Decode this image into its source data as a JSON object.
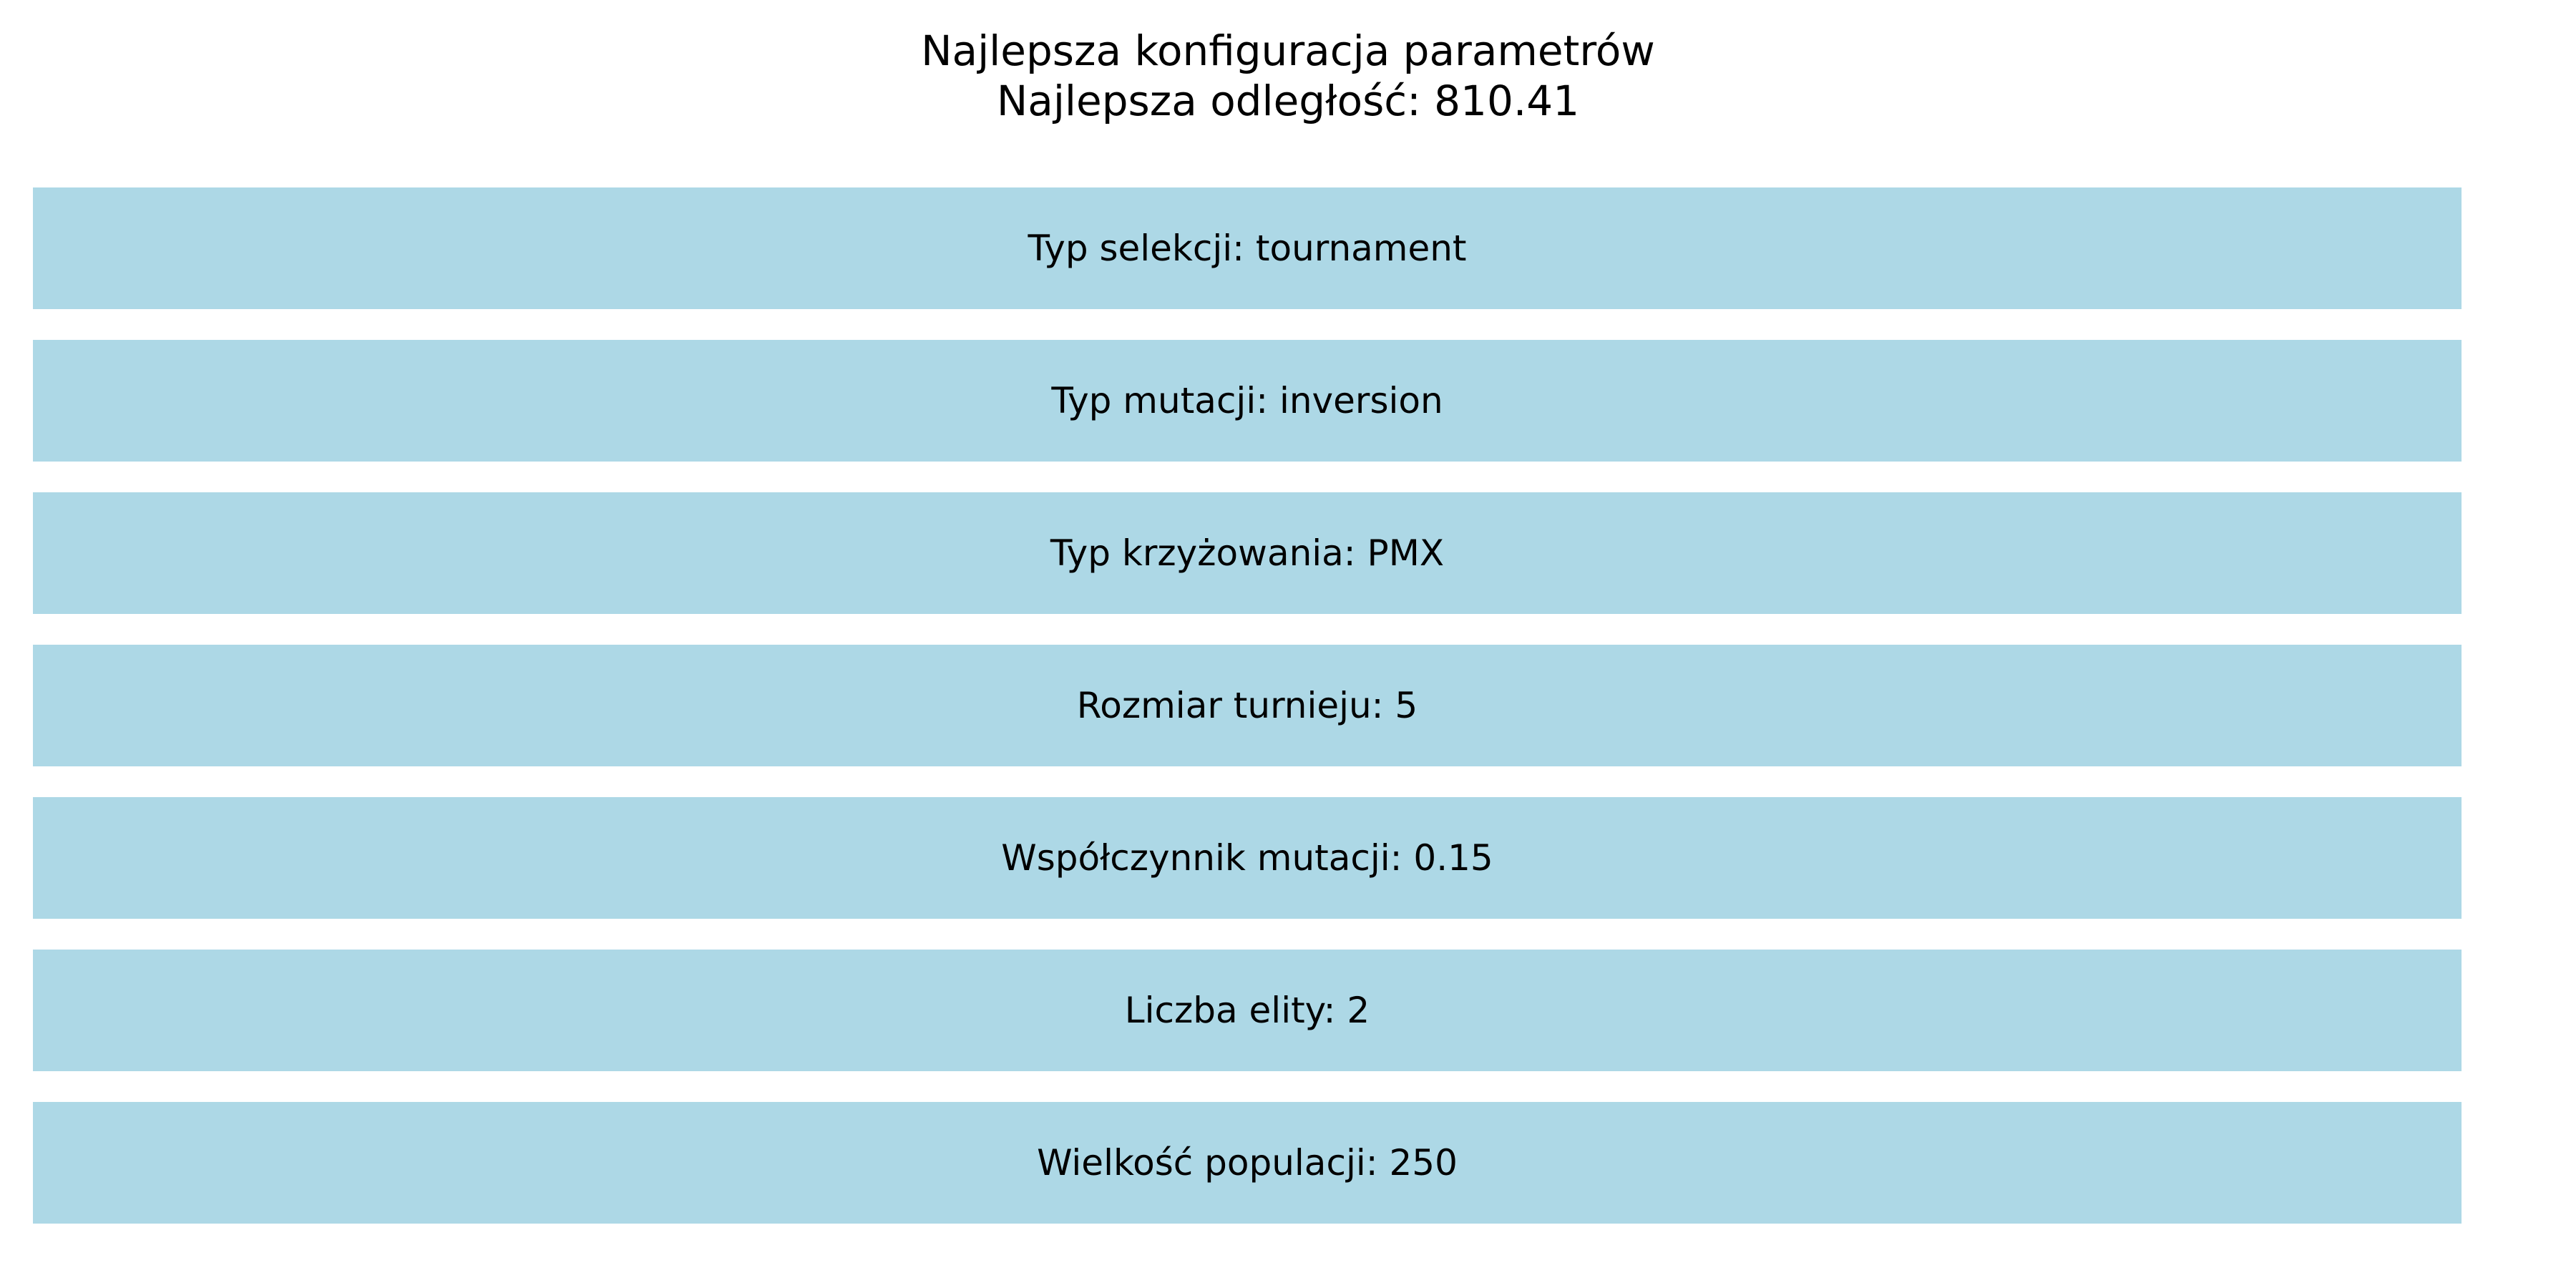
{
  "chart_data": {
    "type": "table",
    "title": "Najlepsza konfiguracja parametrów",
    "subtitle": "Najlepsza odległość: 810.41",
    "rows": [
      "Typ selekcji: tournament",
      "Typ mutacji: inversion",
      "Typ krzyżowania: PMX",
      "Rozmiar turnieju: 5",
      "Współczynnik mutacji: 0.15",
      "Liczba elity: 2",
      "Wielkość populacji: 250"
    ],
    "bar_color": "#add8e6",
    "grid": false
  }
}
